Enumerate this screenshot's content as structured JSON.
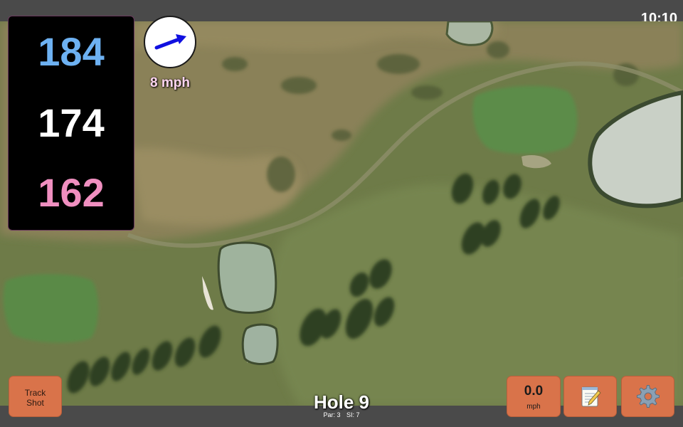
{
  "status_bar": {
    "time": "10:10"
  },
  "distances": {
    "back": "184",
    "middle": "174",
    "front": "162"
  },
  "wind": {
    "speed_label": "8 mph",
    "arrow_icon": "wind-arrow-icon",
    "arrow_color": "#1010e0"
  },
  "buttons": {
    "track_shot_label": "Track\nShot",
    "speed_value": "0.0",
    "speed_unit": "mph",
    "notes_icon": "notepad-icon",
    "settings_icon": "gear-icon"
  },
  "hole": {
    "title": "Hole 9",
    "par_label": "Par: 3",
    "si_label": "SI: 7"
  },
  "colors": {
    "button": "#d9734a",
    "back_distance": "#6db1f2",
    "middle_distance": "#ffffff",
    "front_distance": "#f08fc0",
    "wind_text": "#ffd6f0"
  }
}
